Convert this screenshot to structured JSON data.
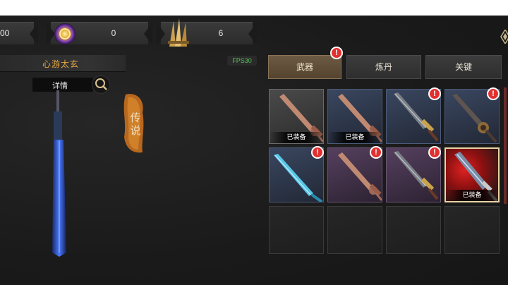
{
  "currency": {
    "first_value": "00",
    "second_value": "0",
    "third_value": "6"
  },
  "hero": {
    "name": "心游太玄",
    "detail_label": "详情",
    "rarity_label": "传说"
  },
  "fps_label": "FPS30",
  "tabs": [
    {
      "label": "武器",
      "active": true,
      "alert": true
    },
    {
      "label": "炼丹",
      "active": false,
      "alert": false
    },
    {
      "label": "关键",
      "active": false,
      "alert": false
    }
  ],
  "alert_glyph": "!",
  "equipped_label": "已装备",
  "grid": [
    {
      "rarity": "gray",
      "equipped": true,
      "alert": false,
      "weapon": "bronze-sword"
    },
    {
      "rarity": "blue",
      "equipped": true,
      "alert": false,
      "weapon": "bronze-sword"
    },
    {
      "rarity": "blue",
      "equipped": false,
      "alert": true,
      "weapon": "iron-sword-gold-guard"
    },
    {
      "rarity": "blue",
      "equipped": false,
      "alert": true,
      "weapon": "dark-ornate-sword"
    },
    {
      "rarity": "blue",
      "equipped": false,
      "alert": true,
      "weapon": "ice-crystal-sword"
    },
    {
      "rarity": "purple",
      "equipped": false,
      "alert": true,
      "weapon": "bronze-sword"
    },
    {
      "rarity": "purple",
      "equipped": false,
      "alert": true,
      "weapon": "iron-sword-gold-guard"
    },
    {
      "rarity": "red",
      "equipped": true,
      "alert": false,
      "weapon": "jade-engraved-sword"
    },
    {
      "rarity": "empty"
    },
    {
      "rarity": "empty"
    },
    {
      "rarity": "empty"
    },
    {
      "rarity": "empty"
    }
  ],
  "colors": {
    "accent_gold": "#e2a640",
    "alert_red": "#e23030",
    "fps_green": "#56c956"
  }
}
